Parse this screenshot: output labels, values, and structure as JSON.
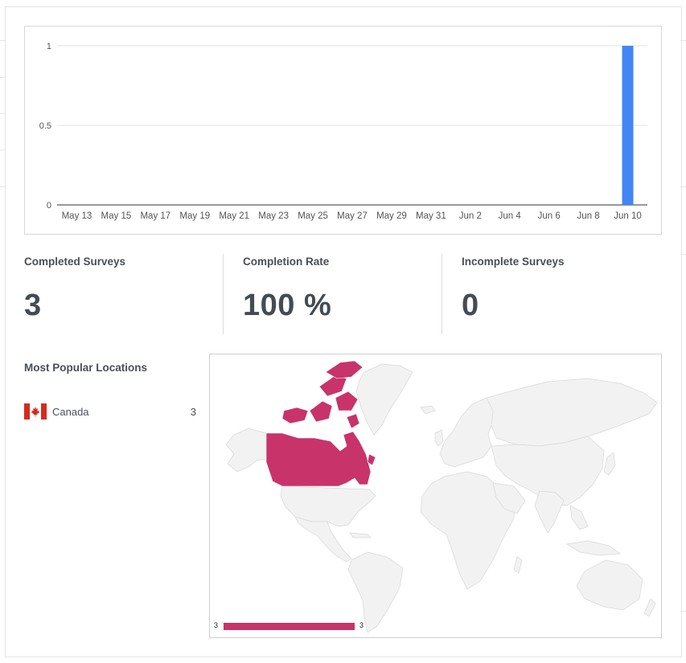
{
  "chart_data": {
    "type": "bar",
    "categories": [
      "May 13",
      "May 15",
      "May 17",
      "May 19",
      "May 21",
      "May 23",
      "May 25",
      "May 27",
      "May 29",
      "May 31",
      "Jun 2",
      "Jun 4",
      "Jun 6",
      "Jun 8",
      "Jun 10"
    ],
    "y_ticks": [
      "0",
      "0.5",
      "1"
    ],
    "ylim": [
      0,
      1
    ],
    "values": [
      0,
      0,
      0,
      0,
      0,
      0,
      0,
      0,
      0,
      0,
      0,
      0,
      0,
      0,
      1
    ],
    "bar_color": "#4285f4",
    "grid": true
  },
  "stats": {
    "completed": {
      "label": "Completed Surveys",
      "value": "3"
    },
    "rate": {
      "label": "Completion Rate",
      "value": "100 %"
    },
    "incomplete": {
      "label": "Incomplete Surveys",
      "value": "0"
    }
  },
  "locations": {
    "title": "Most Popular Locations",
    "items": [
      {
        "name": "Canada",
        "count": "3",
        "flag": "canada-flag-icon"
      }
    ]
  },
  "map": {
    "highlight_color": "#c8336a",
    "base_color": "#f2f2f2",
    "highlighted_country": "Canada",
    "legend_min": "3",
    "legend_max": "3"
  }
}
